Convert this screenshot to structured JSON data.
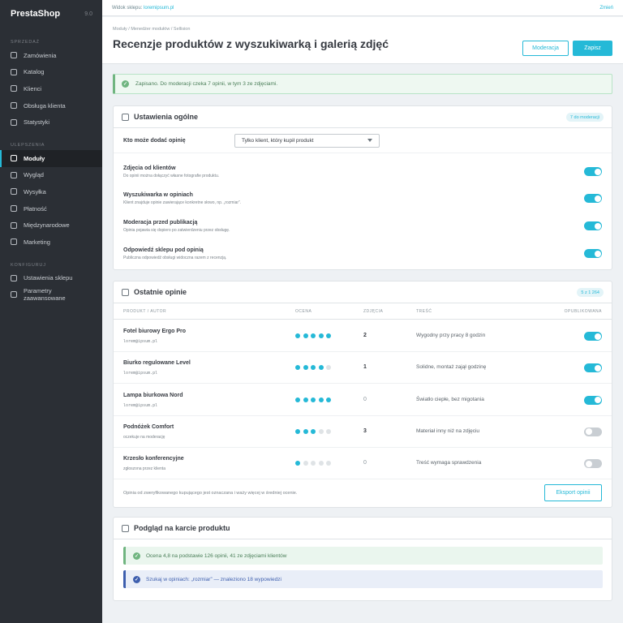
{
  "sidebar": {
    "brand": "PrestaShop",
    "version": "9.0",
    "sections": [
      {
        "title": "SPRZEDAŻ",
        "items": [
          {
            "label": "Zamówienia"
          },
          {
            "label": "Katalog"
          },
          {
            "label": "Klienci"
          },
          {
            "label": "Obsługa klienta"
          },
          {
            "label": "Statystyki"
          }
        ]
      },
      {
        "title": "ULEPSZENIA",
        "items": [
          {
            "label": "Moduły",
            "active": true
          },
          {
            "label": "Wygląd"
          },
          {
            "label": "Wysyłka"
          },
          {
            "label": "Płatność"
          },
          {
            "label": "Międzynarodowe"
          },
          {
            "label": "Marketing"
          }
        ]
      },
      {
        "title": "KONFIGURUJ",
        "items": [
          {
            "label": "Ustawienia sklepu"
          },
          {
            "label": "Parametry zaawansowane"
          }
        ]
      }
    ]
  },
  "topbar": {
    "store_label": "Widok sklepu:",
    "store_url": "loremipsum.pl",
    "change": "Zmień"
  },
  "header": {
    "breadcrumb": [
      "Moduły",
      "Menedżer modułów",
      "Sellision"
    ],
    "title": "Recenzje produktów z wyszukiwarką i galerią zdjęć",
    "moderation_button": "Moderacja",
    "save_button": "Zapisz"
  },
  "alert": {
    "text": "Zapisano. Do moderacji czeka 7 opinii, w tym 3 ze zdjęciami."
  },
  "general": {
    "title": "Ustawienia ogólne",
    "badge": "7 do moderacji",
    "who_label": "Kto może dodać opinię",
    "who_value": "Tylko klient, który kupił produkt",
    "settings": [
      {
        "title": "Zdjęcia od klientów",
        "desc": "Do opinii można dołączyć własne fotografie produktu.",
        "on": true
      },
      {
        "title": "Wyszukiwarka w opiniach",
        "desc": "Klient znajduje opinie zawierające konkretne słowo, np. „rozmiar”.",
        "on": true
      },
      {
        "title": "Moderacja przed publikacją",
        "desc": "Opinia pojawia się dopiero po zatwierdzeniu przez obsługę.",
        "on": true
      },
      {
        "title": "Odpowiedź sklepu pod opinią",
        "desc": "Publiczna odpowiedź obsługi widoczna razem z recenzją.",
        "on": true
      }
    ]
  },
  "reviews": {
    "title": "Ostatnie opinie",
    "badge": "5 z 1 264",
    "columns": {
      "product": "PRODUKT / AUTOR",
      "rating": "OCENA",
      "photos": "ZDJĘCIA",
      "content": "TREŚĆ",
      "published": "OPUBLIKOWANA"
    },
    "rows": [
      {
        "product": "Fotel biurowy Ergo Pro",
        "author": "lorem@ipsum.pl",
        "rating": 5,
        "photos": "2",
        "content": "Wygodny przy pracy 8 godzin",
        "published": true
      },
      {
        "product": "Biurko regulowane Level",
        "author": "lorem@ipsum.pl",
        "rating": 4,
        "photos": "1",
        "content": "Solidne, montaż zajął godzinę",
        "published": true
      },
      {
        "product": "Lampa biurkowa Nord",
        "author": "lorem@ipsum.pl",
        "rating": 5,
        "photos": "0",
        "content": "Światło ciepłe, bez migotania",
        "published": true
      },
      {
        "product": "Podnóżek Comfort",
        "author": "oczekuje na moderację",
        "rating": 3,
        "photos": "3",
        "content": "Materiał inny niż na zdjęciu",
        "published": false
      },
      {
        "product": "Krzesło konferencyjne",
        "author": "zgłoszona przez klienta",
        "rating": 1,
        "photos": "0",
        "content": "Treść wymaga sprawdzenia",
        "published": false
      }
    ],
    "footer_note": "Opinia od zweryfikowanego kupującego jest oznaczana i waży więcej w średniej ocenie.",
    "export_button": "Eksport opinii"
  },
  "preview": {
    "title": "Podgląd na karcie produktu",
    "rating_text": "Ocena 4,8 na podstawie 126 opinii, 41 ze zdjęciami klientów",
    "search_text": "Szukaj w opiniach: „rozmiar” — znaleziono 18 wypowiedzi"
  },
  "colors": {
    "accent": "#25b9d7",
    "sidebar": "#2b2f35",
    "success": "#70b580",
    "info": "#3e5fae"
  }
}
